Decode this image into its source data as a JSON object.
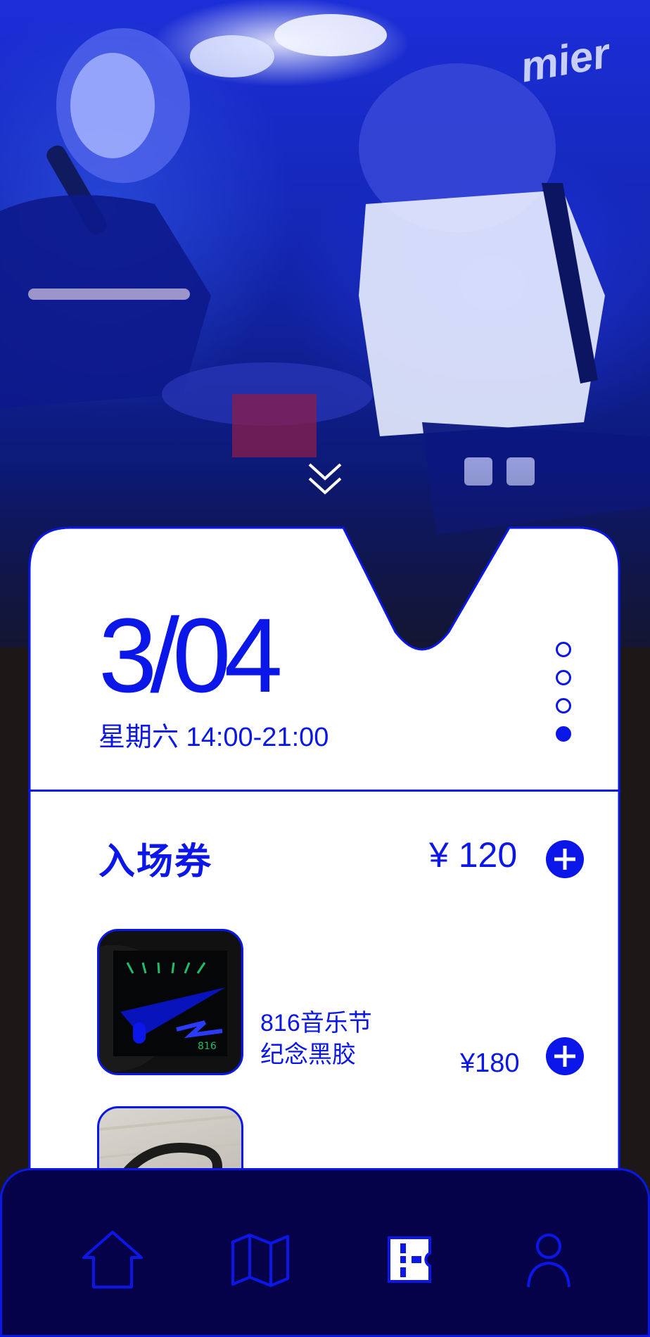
{
  "event": {
    "date": "3/04",
    "weekday_time": "星期六  14:00-21:00"
  },
  "pager": {
    "total": 4,
    "active_index": 3
  },
  "ticket": {
    "label": "入场券",
    "price": "¥ 120"
  },
  "products": [
    {
      "name_line1": "816音乐节",
      "name_line2": "纪念黑胶",
      "price": "¥180"
    },
    {
      "name_line1": "",
      "name_line2": "",
      "price": ""
    }
  ],
  "nav": {
    "tabs": [
      {
        "icon": "home-icon",
        "active": false
      },
      {
        "icon": "map-icon",
        "active": false
      },
      {
        "icon": "ticket-icon",
        "active": true
      },
      {
        "icon": "profile-icon",
        "active": false
      }
    ]
  },
  "colors": {
    "accent": "#0a17e8",
    "tabbar_bg": "#06024a",
    "card_bg": "#ffffff",
    "page_bg": "#1d1817"
  }
}
